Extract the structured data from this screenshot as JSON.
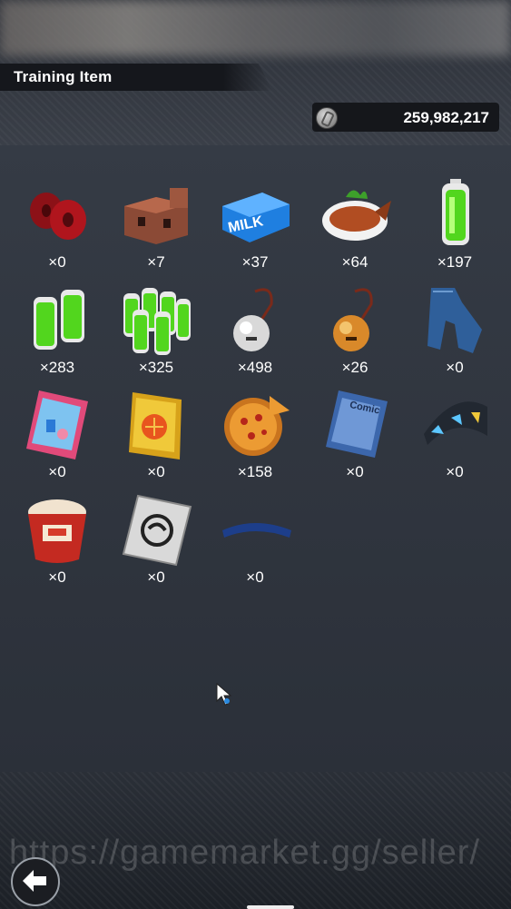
{
  "header": {
    "title": "Training Item"
  },
  "currency": {
    "icon": "coin-icon",
    "value": "259,982,217"
  },
  "items": [
    {
      "name": "weights-icon",
      "qty": "×0"
    },
    {
      "name": "bricks-icon",
      "qty": "×7"
    },
    {
      "name": "milk-carton-icon",
      "qty": "×37"
    },
    {
      "name": "grilled-fish-icon",
      "qty": "×64"
    },
    {
      "name": "battery-icon",
      "qty": "×197"
    },
    {
      "name": "battery-pack-icon",
      "qty": "×283"
    },
    {
      "name": "battery-bundle-icon",
      "qty": "×325"
    },
    {
      "name": "silver-bell-icon",
      "qty": "×498"
    },
    {
      "name": "gold-bell-icon",
      "qty": "×26"
    },
    {
      "name": "jeans-icon",
      "qty": "×0"
    },
    {
      "name": "magazine-icon",
      "qty": "×0"
    },
    {
      "name": "dragon-ball-book-icon",
      "qty": "×0"
    },
    {
      "name": "pizza-icon",
      "qty": "×158"
    },
    {
      "name": "comic-book-icon",
      "qty": "×0"
    },
    {
      "name": "wristband-icon",
      "qty": "×0"
    },
    {
      "name": "cup-noodle-icon",
      "qty": "×0"
    },
    {
      "name": "symbol-card-icon",
      "qty": "×0"
    },
    {
      "name": "headband-icon",
      "qty": "×0"
    }
  ],
  "watermark": "https://gamemarket.gg/seller/",
  "back_button": {
    "icon": "back-arrow-icon"
  }
}
